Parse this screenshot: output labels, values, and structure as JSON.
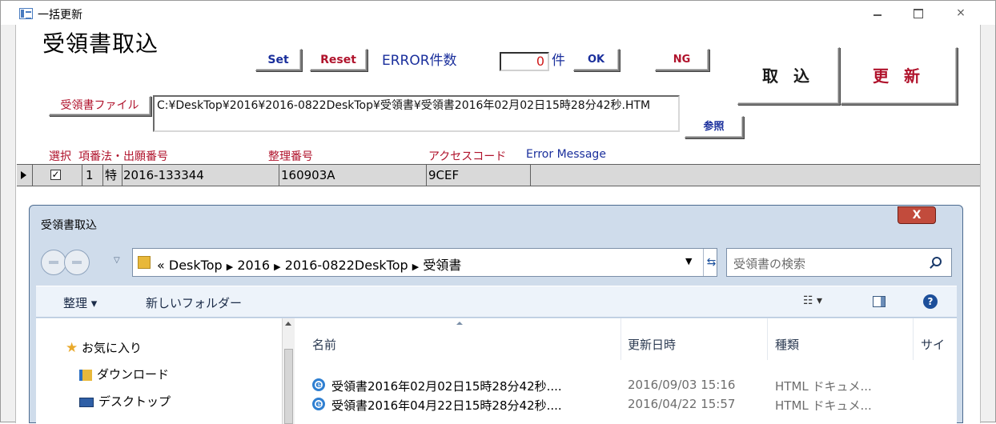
{
  "window": {
    "title": "一括更新"
  },
  "form": {
    "title": "受領書取込",
    "set_label": "Set",
    "reset_label": "Reset",
    "error_label": "ERROR件数",
    "error_count": "0",
    "ken_label": "件",
    "ok_label": "OK",
    "ng_label": "NG",
    "import_label": "取 込",
    "update_label": "更 新",
    "file_label": "受領書ファイル",
    "file_path": "C:¥DeskTop¥2016¥2016-0822DeskTop¥受領書¥受領書2016年02月02日15時28分42秒.HTM",
    "browse_label": "参照",
    "columns": {
      "select": "選択",
      "item_no": "項番",
      "law_app": "法・出願番号",
      "ref_no": "整理番号",
      "access": "アクセスコード",
      "error_msg": "Error Message"
    },
    "row": {
      "checked": "✓",
      "item_no": "1",
      "law": "特",
      "app_no": "2016-133344",
      "ref_no": "160903A",
      "access": "9CEF",
      "error_msg": ""
    }
  },
  "dialog": {
    "title": "受領書取込",
    "close_label": "X",
    "breadcrumb": [
      "«",
      "DeskTop",
      "2016",
      "2016-0822DeskTop",
      "受領書"
    ],
    "search_placeholder": "受領書の検索",
    "organize_label": "整理 ▾",
    "new_folder_label": "新しいフォルダー",
    "nav_items": [
      "お気に入り",
      "ダウンロード",
      "デスクトップ"
    ],
    "headers": {
      "name": "名前",
      "date": "更新日時",
      "type": "種類",
      "size": "サイ"
    },
    "files": [
      {
        "name": "受領書2016年02月02日15時28分42秒....",
        "date": "2016/09/03 15:16",
        "type": "HTML ドキュメ..."
      },
      {
        "name": "受領書2016年04月22日15時28分42秒....",
        "date": "2016/04/22 15:57",
        "type": "HTML ドキュメ..."
      }
    ]
  }
}
